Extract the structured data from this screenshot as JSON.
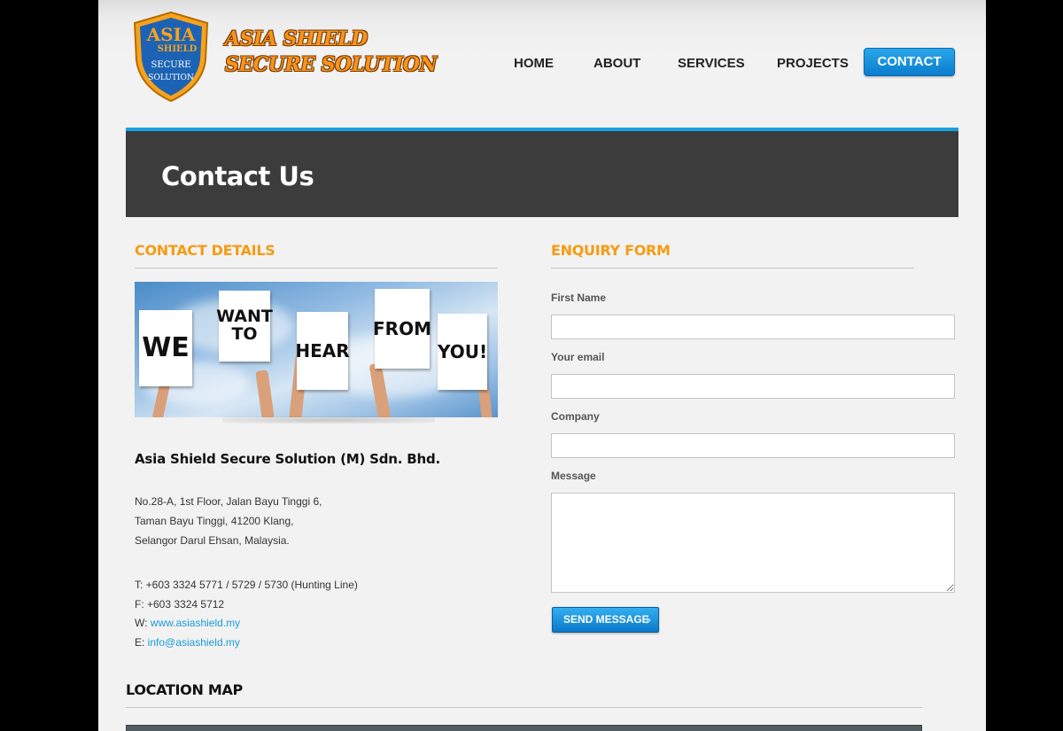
{
  "brand": {
    "badge_line1": "ASIA",
    "badge_line2": "SHIELD",
    "badge_line3": "SECURE",
    "badge_line4": "SOLUTION",
    "name_line1": "ASIA SHIELD",
    "name_line2": "SECURE SOLUTION"
  },
  "nav": {
    "items": [
      {
        "label": "HOME"
      },
      {
        "label": "ABOUT"
      },
      {
        "label": "SERVICES"
      },
      {
        "label": "PROJECTS"
      }
    ],
    "active_label": "CONTACT"
  },
  "banner": {
    "title": "Contact Us"
  },
  "contact": {
    "heading": "CONTACT DETAILS",
    "signs": [
      "WE",
      "WANT TO",
      "HEAR",
      "FROM",
      "YOU!"
    ],
    "company": "Asia Shield Secure Solution (M) Sdn. Bhd.",
    "address": [
      "No.28-A, 1st Floor, Jalan Bayu Tinggi 6,",
      "Taman Bayu Tinggi, 41200 Klang,",
      "Selangor Darul Ehsan, Malaysia."
    ],
    "phone": "T: +603 3324 5771 / 5729 / 5730 (Hunting Line)",
    "fax": "F: +603 3324 5712",
    "web_prefix": "W: ",
    "web": "www.asiashield.my",
    "email_prefix": "E: ",
    "email": "info@asiashield.my"
  },
  "form": {
    "heading": "ENQUIRY FORM",
    "first_name_label": "First Name",
    "email_label": "Your email",
    "company_label": "Company",
    "message_label": "Message",
    "submit_label": "SEND MESSAGE"
  },
  "map": {
    "heading": "LOCATION MAP"
  },
  "colors": {
    "accent_orange": "#f59b12",
    "accent_blue": "#19a0e0",
    "banner_bg": "#3c3c3c"
  }
}
